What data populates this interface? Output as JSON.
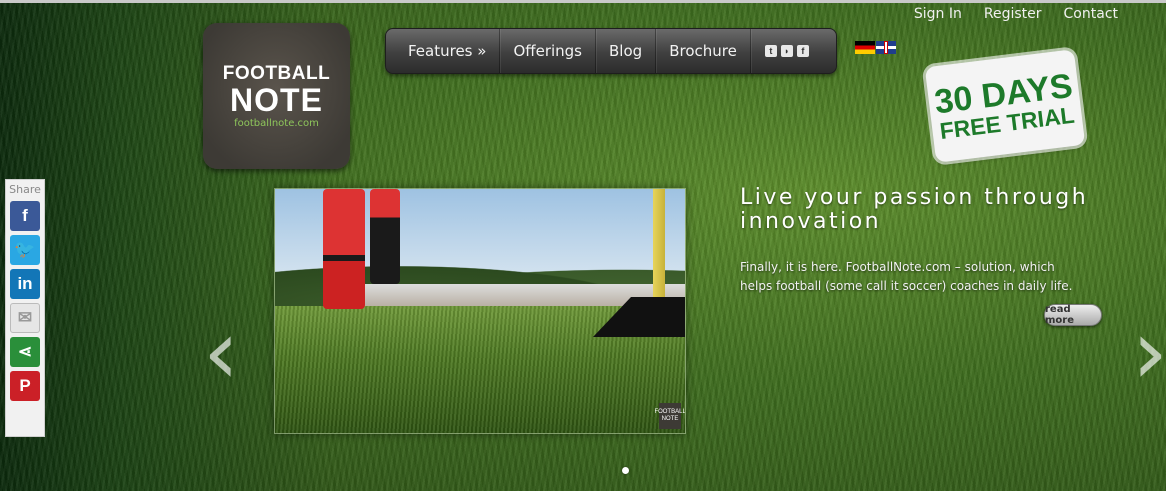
{
  "topbar": {
    "links": [
      "Sign In",
      "Register",
      "Contact"
    ]
  },
  "logo": {
    "line1": "FOOTBALL",
    "line2": "NOTE",
    "url": "footballnote.com"
  },
  "nav": {
    "items": [
      "Features »",
      "Offerings",
      "Blog",
      "Brochure"
    ],
    "social": [
      "twitter-icon",
      "rss-icon",
      "facebook-icon"
    ]
  },
  "flags": [
    "german-flag",
    "uk-flag"
  ],
  "trial": {
    "line1": "30 DAYS",
    "line2": "FREE TRIAL"
  },
  "share": {
    "label": "Share",
    "buttons": [
      "facebook",
      "twitter",
      "linkedin",
      "email",
      "share",
      "pinterest"
    ]
  },
  "slide": {
    "headline": "Live your passion through innovation",
    "text": "Finally, it is here. FootballNote.com – solution, which helps football (some call it soccer) coaches in daily life.",
    "read_more": "read more",
    "photo_badge": "FOOTBALL NOTE"
  },
  "carousel": {
    "prev": "‹",
    "next": "›"
  }
}
